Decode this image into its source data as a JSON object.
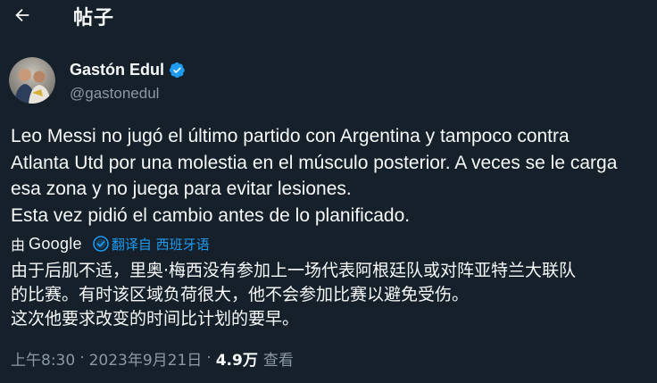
{
  "header": {
    "title": "帖子"
  },
  "author": {
    "display_name": "Gastón Edul",
    "handle": "@gastonedul"
  },
  "tweet": {
    "text": "Leo Messi no jugó el último partido con Argentina y tampoco contra\nAtlanta Utd por una molestia en el músculo posterior. A veces se le carga\nesa zona y no juega para evitar lesiones.\nEsta vez pidió el cambio antes de lo planificado."
  },
  "translation": {
    "by_label": "由",
    "brand": "Google",
    "translated_from": "翻译自 西班牙语",
    "text": "由于后肌不适，里奥·梅西没有参加上一场代表阿根廷队或对阵亚特兰大联队\n的比赛。有时该区域负荷很大，他不会参加比赛以避免受伤。\n这次他要求改变的时间比计划的要早。"
  },
  "meta": {
    "time": "上午8:30",
    "separator1": "·",
    "date": "2023年9月21日",
    "separator2": "·",
    "views_count": "4.9万",
    "views_label": "查看"
  },
  "colors": {
    "background": "#15202b",
    "text_primary": "#f7f9f9",
    "text_secondary": "#8b98a5",
    "accent": "#1d9bf0",
    "verified": "#1d9bf0"
  },
  "icons": {
    "back": "arrow-left-icon",
    "verified": "verified-badge-icon",
    "translated": "check-circle-icon"
  }
}
